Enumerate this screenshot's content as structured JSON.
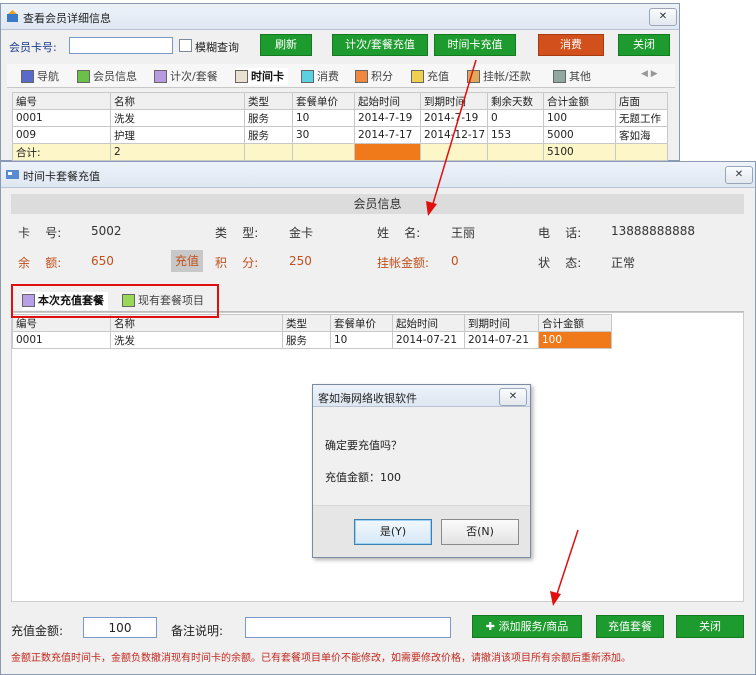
{
  "back_window": {
    "title": "查看会员详细信息",
    "card_label": "会员卡号:",
    "card_value": "",
    "fuzzy_label": "模糊查询",
    "buttons": {
      "refresh": "刷新",
      "times_recharge": "计次/套餐充值",
      "timecard_recharge": "时间卡充值",
      "consume": "消费",
      "close": "关闭"
    },
    "tabs": [
      "导航",
      "会员信息",
      "计次/套餐",
      "时间卡",
      "消费",
      "积分",
      "充值",
      "挂帐/还款",
      "其他"
    ],
    "table": {
      "headers": [
        "编号",
        "名称",
        "类型",
        "套餐单价",
        "起始时间",
        "到期时间",
        "剩余天数",
        "合计金额",
        "店面"
      ],
      "rows": [
        [
          "0001",
          "洗发",
          "服务",
          "10",
          "2014-7-19",
          "2014-7-19",
          "0",
          "100",
          "无题工作"
        ],
        [
          "009",
          "护理",
          "服务",
          "30",
          "2014-7-17",
          "2014-12-17",
          "153",
          "5000",
          "客如海"
        ]
      ],
      "total": {
        "label": "合计:",
        "count": "2",
        "amount": "5100"
      }
    }
  },
  "front_window": {
    "title": "时间卡套餐充值",
    "section_title": "会员信息",
    "info": {
      "card_label": "卡    号:",
      "card_value": "5002",
      "type_label": "类    型:",
      "type_value": "金卡",
      "name_label": "姓    名:",
      "name_value": "王丽",
      "phone_label": "电    话:",
      "phone_value": "13888888888",
      "balance_label": "余    额:",
      "balance_value": "650",
      "recharge_btn": "充值",
      "points_label": "积    分:",
      "points_value": "250",
      "debt_label": "挂帐金额:",
      "debt_value": "0",
      "status_label": "状    态:",
      "status_value": "正常"
    },
    "tabs": [
      "本次充值套餐",
      "现有套餐项目"
    ],
    "table": {
      "headers": [
        "编号",
        "名称",
        "类型",
        "套餐单价",
        "起始时间",
        "到期时间",
        "合计金额"
      ],
      "rows": [
        [
          "0001",
          "洗发",
          "服务",
          "10",
          "2014-07-21",
          "2014-07-21",
          "100"
        ]
      ]
    },
    "footer": {
      "amount_label": "充值金额:",
      "amount_value": "100",
      "note_label": "备注说明:",
      "note_value": "",
      "add_btn": "添加服务/商品",
      "package_btn": "充值套餐",
      "close_btn": "关闭",
      "hint": "金额正数充值时间卡，金额负数撤消现有时间卡的余额。已有套餐项目单价不能修改，如需要修改价格，请撤消该项目所有余额后重新添加。"
    }
  },
  "dialog": {
    "title": "客如海网络收银软件",
    "question": "确定要充值吗？",
    "amount_line": "充值金额：100",
    "yes": "是(Y)",
    "no": "否(N)"
  },
  "colors": {
    "green": "#1e9b2e",
    "orange": "#d2501c",
    "highlight": "#f07a1a",
    "annotation_red": "#e01010"
  }
}
